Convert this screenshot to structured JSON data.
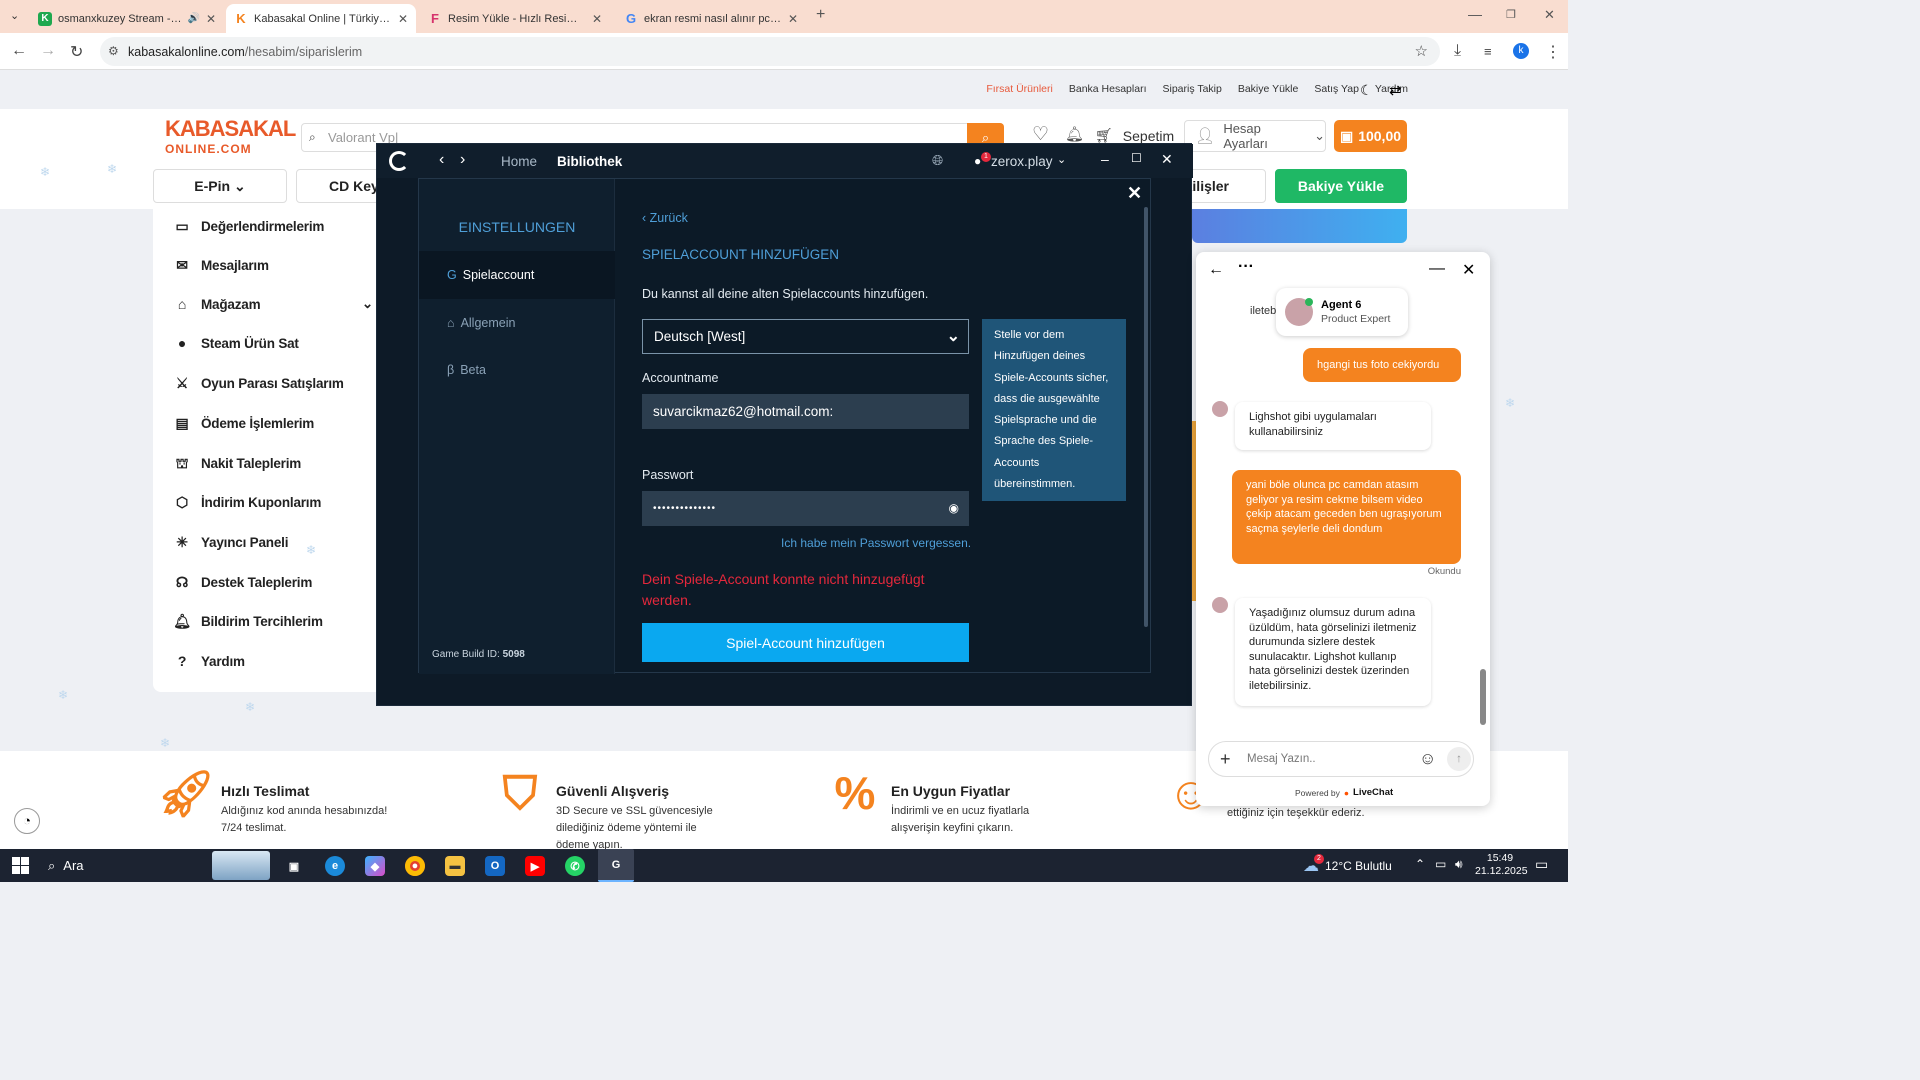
{
  "browser": {
    "tabs": [
      {
        "title": "osmanxkuzey Stream - Wat",
        "favicon": "K",
        "color": "#1fa84f"
      },
      {
        "title": "Kabasakal Online | Türkiye'nin E",
        "favicon": "K",
        "color": "#f4831f"
      },
      {
        "title": "Resim Yükle - Hızlı Resim Paylaş",
        "favicon": "F",
        "color": "#d6336c"
      },
      {
        "title": "ekran resmi nasıl alınır pc - Goo",
        "favicon": "G",
        "color": "#4285f4"
      }
    ],
    "url_domain": "kabasakalonline.com",
    "url_path": "/hesabim/siparislerim",
    "profile_initial": "k"
  },
  "site": {
    "toplinks": [
      "Fırsat Ürünleri",
      "Banka Hesapları",
      "Sipariş Takip",
      "Bakiye Yükle",
      "Satış Yap",
      "Yardım"
    ],
    "logo_top": "KABASAKAL",
    "logo_bottom": "ONLINE.COM",
    "search_placeholder": "Valorant Vp|",
    "cart_label": "Sepetim",
    "account_label": "Hesap Ayarları",
    "balance": "100,00",
    "categories": {
      "epin": "E-Pin",
      "cdkey": "CD Key",
      "partial": "kilişler",
      "topup": "Bakiye Yükle"
    },
    "side_menu": [
      "Değerlendirmelerim",
      "Mesajlarım",
      "Mağazam",
      "Steam Ürün Sat",
      "Oyun Parası Satışlarım",
      "Ödeme İşlemlerim",
      "Nakit Taleplerim",
      "İndirim Kuponlarım",
      "Yayıncı Paneli",
      "Destek Taleplerim",
      "Bildirim Tercihlerim",
      "Yardım"
    ],
    "features": [
      {
        "title": "Hızlı Teslimat",
        "text": "Aldığınız kod anında hesabınızda! 7/24 teslimat."
      },
      {
        "title": "Güvenli Alışveriş",
        "text": "3D Secure ve SSL güvencesiyle dilediğiniz ödeme yöntemi ile ödeme yapın."
      },
      {
        "title": "En Uygun Fiyatlar",
        "text": "İndirimli ve en ucuz fiyatlarla alışverişin keyfini çıkarın."
      },
      {
        "title": "",
        "text": "ettiğiniz için teşekkür ederiz."
      }
    ]
  },
  "launcher": {
    "nav_home": "Home",
    "nav_library": "Bibliothek",
    "user": "zerox.play",
    "notif_count": "1",
    "settings_title": "EINSTELLUNGEN",
    "tabs": [
      "Spielaccount",
      "Allgemein",
      "Beta"
    ],
    "build_label": "Game Build ID:",
    "build_id": "5098",
    "back": "Zurück",
    "heading": "SPIELACCOUNT HINZUFÜGEN",
    "intro": "Du kannst all deine alten Spielaccounts hinzufügen.",
    "language": "Deutsch [West]",
    "account_label": "Accountname",
    "account_value": "suvarcikmaz62@hotmail.com:",
    "password_label": "Passwort",
    "password_value": "••••••••••••••",
    "forgot": "Ich habe mein Passwort vergessen.",
    "error": "Dein Spiele-Account konnte nicht hinzugefügt werden.",
    "submit": "Spiel-Account hinzufügen",
    "tooltip": "Stelle vor dem Hinzufügen deines Spiele-Accounts sicher, dass die ausgewählte Spielsprache und die Sprache des Spiele-Accounts übereinstimmen."
  },
  "chat": {
    "agent_name": "Agent 6",
    "agent_role": "Product Expert",
    "partial_text": "iletebi",
    "messages": [
      {
        "from": "me",
        "text": "hgangi tus foto cekiyordu"
      },
      {
        "from": "them",
        "text": "Lighshot gibi uygulamaları kullanabilirsiniz"
      },
      {
        "from": "me",
        "text": "yani böle olunca pc camdan atasım geliyor ya resim cekme bilsem video çekip atacam geceden ben ugraşıyorum saçma şeylerle deli dondum"
      },
      {
        "from": "them",
        "text": "Yaşadığınız olumsuz durum adına üzüldüm, hata görselinizi iletmeniz durumunda sizlere destek sunulacaktır. Lighshot kullanıp hata görselinizi destek üzerinden iletebilirsiniz."
      }
    ],
    "read_status": "Okundu",
    "input_placeholder": "Mesaj Yazın..",
    "powered_by": "Powered by",
    "brand": "LiveChat"
  },
  "taskbar": {
    "search": "Ara",
    "weather_badge": "2",
    "weather": "12°C  Bulutlu",
    "time": "15:49",
    "date": "21.12.2025"
  }
}
